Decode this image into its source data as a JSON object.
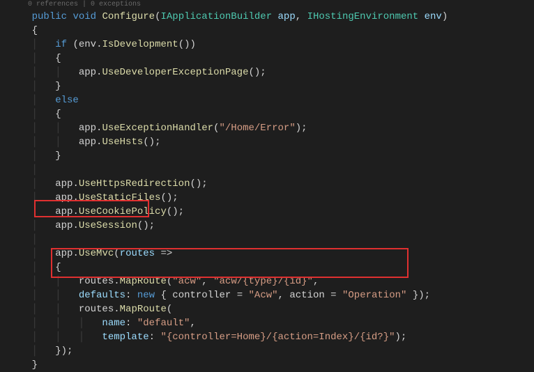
{
  "codelens": "0 references | 0 exceptions",
  "tokens": {
    "public": "public",
    "void": "void",
    "configure": "Configure",
    "iappbuilder": "IApplicationBuilder",
    "app": "app",
    "ihostenv": "IHostingEnvironment",
    "env": "env",
    "if": "if",
    "isdev": "IsDevelopment",
    "usedevexc": "UseDeveloperExceptionPage",
    "else": "else",
    "useexchandler": "UseExceptionHandler",
    "homeerror": "\"/Home/Error\"",
    "usehsts": "UseHsts",
    "usehttps": "UseHttpsRedirection",
    "usestatic": "UseStaticFiles",
    "usecookie": "UseCookiePolicy",
    "usesession": "UseSession",
    "usemvc": "UseMvc",
    "routes": "routes",
    "arrow": "=>",
    "maproute": "MapRoute",
    "acw": "\"acw\"",
    "acwtemplate": "\"acw/{type}/{id}\"",
    "defaults": "defaults",
    "new": "new",
    "controller": "controller",
    "acwval": "\"Acw\"",
    "action": "action",
    "operation": "\"Operation\"",
    "name": "name",
    "default": "\"default\"",
    "template": "template",
    "defaulttemplate": "\"{controller=Home}/{action=Index}/{id?}\""
  }
}
